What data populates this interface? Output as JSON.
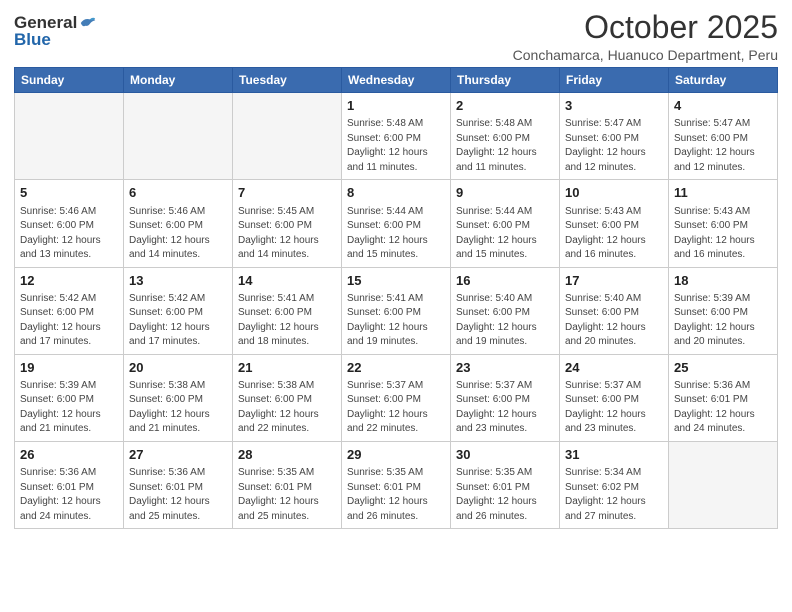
{
  "logo": {
    "general": "General",
    "blue": "Blue"
  },
  "header": {
    "month": "October 2025",
    "location": "Conchamarca, Huanuco Department, Peru"
  },
  "days_of_week": [
    "Sunday",
    "Monday",
    "Tuesday",
    "Wednesday",
    "Thursday",
    "Friday",
    "Saturday"
  ],
  "weeks": [
    [
      {
        "day": "",
        "info": ""
      },
      {
        "day": "",
        "info": ""
      },
      {
        "day": "",
        "info": ""
      },
      {
        "day": "1",
        "info": "Sunrise: 5:48 AM\nSunset: 6:00 PM\nDaylight: 12 hours\nand 11 minutes."
      },
      {
        "day": "2",
        "info": "Sunrise: 5:48 AM\nSunset: 6:00 PM\nDaylight: 12 hours\nand 11 minutes."
      },
      {
        "day": "3",
        "info": "Sunrise: 5:47 AM\nSunset: 6:00 PM\nDaylight: 12 hours\nand 12 minutes."
      },
      {
        "day": "4",
        "info": "Sunrise: 5:47 AM\nSunset: 6:00 PM\nDaylight: 12 hours\nand 12 minutes."
      }
    ],
    [
      {
        "day": "5",
        "info": "Sunrise: 5:46 AM\nSunset: 6:00 PM\nDaylight: 12 hours\nand 13 minutes."
      },
      {
        "day": "6",
        "info": "Sunrise: 5:46 AM\nSunset: 6:00 PM\nDaylight: 12 hours\nand 14 minutes."
      },
      {
        "day": "7",
        "info": "Sunrise: 5:45 AM\nSunset: 6:00 PM\nDaylight: 12 hours\nand 14 minutes."
      },
      {
        "day": "8",
        "info": "Sunrise: 5:44 AM\nSunset: 6:00 PM\nDaylight: 12 hours\nand 15 minutes."
      },
      {
        "day": "9",
        "info": "Sunrise: 5:44 AM\nSunset: 6:00 PM\nDaylight: 12 hours\nand 15 minutes."
      },
      {
        "day": "10",
        "info": "Sunrise: 5:43 AM\nSunset: 6:00 PM\nDaylight: 12 hours\nand 16 minutes."
      },
      {
        "day": "11",
        "info": "Sunrise: 5:43 AM\nSunset: 6:00 PM\nDaylight: 12 hours\nand 16 minutes."
      }
    ],
    [
      {
        "day": "12",
        "info": "Sunrise: 5:42 AM\nSunset: 6:00 PM\nDaylight: 12 hours\nand 17 minutes."
      },
      {
        "day": "13",
        "info": "Sunrise: 5:42 AM\nSunset: 6:00 PM\nDaylight: 12 hours\nand 17 minutes."
      },
      {
        "day": "14",
        "info": "Sunrise: 5:41 AM\nSunset: 6:00 PM\nDaylight: 12 hours\nand 18 minutes."
      },
      {
        "day": "15",
        "info": "Sunrise: 5:41 AM\nSunset: 6:00 PM\nDaylight: 12 hours\nand 19 minutes."
      },
      {
        "day": "16",
        "info": "Sunrise: 5:40 AM\nSunset: 6:00 PM\nDaylight: 12 hours\nand 19 minutes."
      },
      {
        "day": "17",
        "info": "Sunrise: 5:40 AM\nSunset: 6:00 PM\nDaylight: 12 hours\nand 20 minutes."
      },
      {
        "day": "18",
        "info": "Sunrise: 5:39 AM\nSunset: 6:00 PM\nDaylight: 12 hours\nand 20 minutes."
      }
    ],
    [
      {
        "day": "19",
        "info": "Sunrise: 5:39 AM\nSunset: 6:00 PM\nDaylight: 12 hours\nand 21 minutes."
      },
      {
        "day": "20",
        "info": "Sunrise: 5:38 AM\nSunset: 6:00 PM\nDaylight: 12 hours\nand 21 minutes."
      },
      {
        "day": "21",
        "info": "Sunrise: 5:38 AM\nSunset: 6:00 PM\nDaylight: 12 hours\nand 22 minutes."
      },
      {
        "day": "22",
        "info": "Sunrise: 5:37 AM\nSunset: 6:00 PM\nDaylight: 12 hours\nand 22 minutes."
      },
      {
        "day": "23",
        "info": "Sunrise: 5:37 AM\nSunset: 6:00 PM\nDaylight: 12 hours\nand 23 minutes."
      },
      {
        "day": "24",
        "info": "Sunrise: 5:37 AM\nSunset: 6:00 PM\nDaylight: 12 hours\nand 23 minutes."
      },
      {
        "day": "25",
        "info": "Sunrise: 5:36 AM\nSunset: 6:01 PM\nDaylight: 12 hours\nand 24 minutes."
      }
    ],
    [
      {
        "day": "26",
        "info": "Sunrise: 5:36 AM\nSunset: 6:01 PM\nDaylight: 12 hours\nand 24 minutes."
      },
      {
        "day": "27",
        "info": "Sunrise: 5:36 AM\nSunset: 6:01 PM\nDaylight: 12 hours\nand 25 minutes."
      },
      {
        "day": "28",
        "info": "Sunrise: 5:35 AM\nSunset: 6:01 PM\nDaylight: 12 hours\nand 25 minutes."
      },
      {
        "day": "29",
        "info": "Sunrise: 5:35 AM\nSunset: 6:01 PM\nDaylight: 12 hours\nand 26 minutes."
      },
      {
        "day": "30",
        "info": "Sunrise: 5:35 AM\nSunset: 6:01 PM\nDaylight: 12 hours\nand 26 minutes."
      },
      {
        "day": "31",
        "info": "Sunrise: 5:34 AM\nSunset: 6:02 PM\nDaylight: 12 hours\nand 27 minutes."
      },
      {
        "day": "",
        "info": ""
      }
    ]
  ]
}
